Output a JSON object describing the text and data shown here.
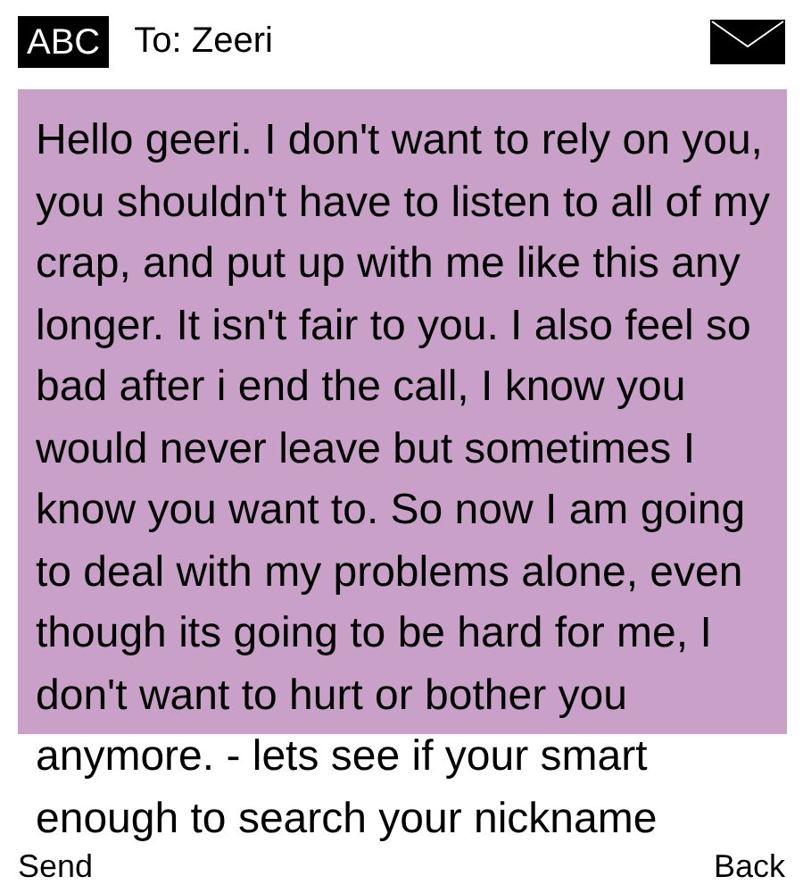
{
  "header": {
    "mode": "ABC",
    "recipient": "To: Zeeri"
  },
  "message": {
    "text": "Hello geeri. I don't want to rely on you, you shouldn't have to listen to all of my crap, and put up with me like this any longer. It isn't fair to you. I also feel so bad after i end the call, I know you would never leave but sometimes I know you want to. So now I am going to deal with my problems alone, even though its going to be hard for me, I don't want to hurt or bother you anymore. - lets see if your smart enough to search your nickname"
  },
  "softkeys": {
    "left": "Send",
    "right": "Back"
  }
}
